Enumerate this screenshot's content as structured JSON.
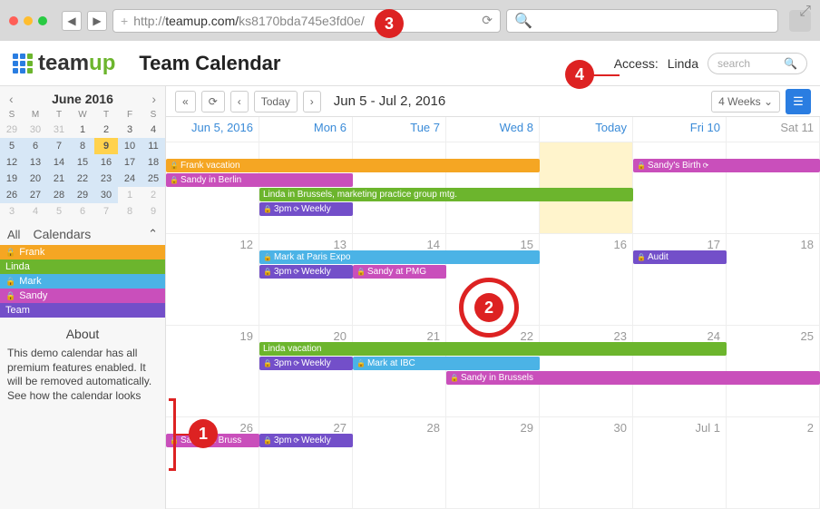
{
  "browser": {
    "url_prefix": "http://",
    "url_host": "teamup.com/",
    "url_path": "ks8170bda745e3fd0e/"
  },
  "header": {
    "logo_a": "team",
    "logo_b": "up",
    "title": "Team Calendar",
    "access_label": "Access:",
    "access_user": "Linda",
    "search_placeholder": "search"
  },
  "toolbar": {
    "today_label": "Today",
    "range_label": "Jun 5 - Jul 2, 2016",
    "view_label": "4 Weeks"
  },
  "mini": {
    "title": "June 2016",
    "dow": [
      "S",
      "M",
      "T",
      "W",
      "T",
      "F",
      "S"
    ],
    "days": [
      {
        "n": "29",
        "o": true
      },
      {
        "n": "30",
        "o": true
      },
      {
        "n": "31",
        "o": true
      },
      {
        "n": "1"
      },
      {
        "n": "2"
      },
      {
        "n": "3"
      },
      {
        "n": "4"
      },
      {
        "n": "5",
        "c": true
      },
      {
        "n": "6",
        "c": true
      },
      {
        "n": "7",
        "c": true
      },
      {
        "n": "8",
        "c": true
      },
      {
        "n": "9",
        "t": true
      },
      {
        "n": "10",
        "c": true
      },
      {
        "n": "11",
        "c": true
      },
      {
        "n": "12",
        "c": true
      },
      {
        "n": "13",
        "c": true
      },
      {
        "n": "14",
        "c": true
      },
      {
        "n": "15",
        "c": true
      },
      {
        "n": "16",
        "c": true
      },
      {
        "n": "17",
        "c": true
      },
      {
        "n": "18",
        "c": true
      },
      {
        "n": "19",
        "c": true
      },
      {
        "n": "20",
        "c": true
      },
      {
        "n": "21",
        "c": true
      },
      {
        "n": "22",
        "c": true
      },
      {
        "n": "23",
        "c": true
      },
      {
        "n": "24",
        "c": true
      },
      {
        "n": "25",
        "c": true
      },
      {
        "n": "26",
        "c": true
      },
      {
        "n": "27",
        "c": true
      },
      {
        "n": "28",
        "c": true
      },
      {
        "n": "29",
        "c": true
      },
      {
        "n": "30",
        "c": true
      },
      {
        "n": "1",
        "o": true
      },
      {
        "n": "2",
        "o": true
      },
      {
        "n": "3",
        "o": true
      },
      {
        "n": "4",
        "o": true
      },
      {
        "n": "5",
        "o": true
      },
      {
        "n": "6",
        "o": true
      },
      {
        "n": "7",
        "o": true
      },
      {
        "n": "8",
        "o": true
      },
      {
        "n": "9",
        "o": true
      }
    ]
  },
  "calendars": {
    "all_label": "All",
    "heading": "Calendars",
    "items": [
      {
        "name": "Frank",
        "locked": true,
        "cls": "c-frank"
      },
      {
        "name": "Linda",
        "locked": false,
        "cls": "c-linda"
      },
      {
        "name": "Mark",
        "locked": true,
        "cls": "c-mark"
      },
      {
        "name": "Sandy",
        "locked": true,
        "cls": "c-sandy"
      },
      {
        "name": "Team",
        "locked": false,
        "cls": "c-team"
      }
    ]
  },
  "about": {
    "heading": "About",
    "text1": "This demo calendar has all premium features enabled. It will be removed automatically.",
    "text2": "See how the calendar looks"
  },
  "days_hd": [
    "Jun 5, 2016",
    "Mon 6",
    "Tue 7",
    "Wed 8",
    "Today",
    "Fri 10",
    "Sat 11"
  ],
  "week_nums": [
    [
      "",
      "",
      "",
      "",
      "",
      "",
      ""
    ],
    [
      "12",
      "13",
      "14",
      "15",
      "16",
      "17",
      "18"
    ],
    [
      "19",
      "20",
      "21",
      "22",
      "23",
      "24",
      "25"
    ],
    [
      "26",
      "27",
      "28",
      "29",
      "30",
      "Jul 1",
      "2"
    ]
  ],
  "events": [
    {
      "row": 0,
      "slot": 0,
      "startCol": 0,
      "span": 4,
      "cls": "c-frank",
      "label": "Frank vacation",
      "locked": true
    },
    {
      "row": 0,
      "slot": 1,
      "startCol": 0,
      "span": 2,
      "cls": "c-sandy",
      "label": "Sandy in Berlin",
      "locked": true
    },
    {
      "row": 0,
      "slot": 0,
      "startCol": 5,
      "span": 2,
      "cls": "c-sandy",
      "label": "Sandy's Birth",
      "locked": true,
      "recurring": true
    },
    {
      "row": 0,
      "slot": 2,
      "startCol": 1,
      "span": 4,
      "cls": "c-linda",
      "label": "Linda in Brussels, marketing practice group mtg."
    },
    {
      "row": 0,
      "slot": 3,
      "startCol": 1,
      "span": 1,
      "cls": "c-team",
      "label": "3pm",
      "locked": true,
      "recurring": true,
      "extra": "Weekly"
    },
    {
      "row": 1,
      "slot": 0,
      "startCol": 1,
      "span": 3,
      "cls": "c-mark",
      "label": "Mark at Paris Expo",
      "locked": true
    },
    {
      "row": 1,
      "slot": 1,
      "startCol": 1,
      "span": 1,
      "cls": "c-team",
      "label": "3pm",
      "locked": true,
      "recurring": true,
      "extra": "Weekly"
    },
    {
      "row": 1,
      "slot": 1,
      "startCol": 2,
      "span": 1,
      "cls": "c-sandy",
      "label": "Sandy at PMG",
      "locked": true
    },
    {
      "row": 1,
      "slot": 0,
      "startCol": 5,
      "span": 1,
      "cls": "c-team",
      "label": "Audit",
      "locked": true
    },
    {
      "row": 2,
      "slot": 0,
      "startCol": 1,
      "span": 5,
      "cls": "c-linda",
      "label": "Linda vacation"
    },
    {
      "row": 2,
      "slot": 1,
      "startCol": 1,
      "span": 1,
      "cls": "c-team",
      "label": "3pm",
      "locked": true,
      "recurring": true,
      "extra": "Weekly"
    },
    {
      "row": 2,
      "slot": 1,
      "startCol": 2,
      "span": 2,
      "cls": "c-mark",
      "label": "Mark at IBC",
      "locked": true
    },
    {
      "row": 2,
      "slot": 2,
      "startCol": 3,
      "span": 4,
      "cls": "c-sandy",
      "label": "Sandy in Brussels",
      "locked": true
    },
    {
      "row": 3,
      "slot": 0,
      "startCol": 0,
      "span": 1,
      "cls": "c-sandy",
      "label": "Sandy in Bruss",
      "locked": true
    },
    {
      "row": 3,
      "slot": 0,
      "startCol": 1,
      "span": 1,
      "cls": "c-team",
      "label": "3pm",
      "locked": true,
      "recurring": true,
      "extra": "Weekly"
    }
  ],
  "badges": {
    "b1": "1",
    "b2": "2",
    "b3": "3",
    "b4": "4"
  }
}
